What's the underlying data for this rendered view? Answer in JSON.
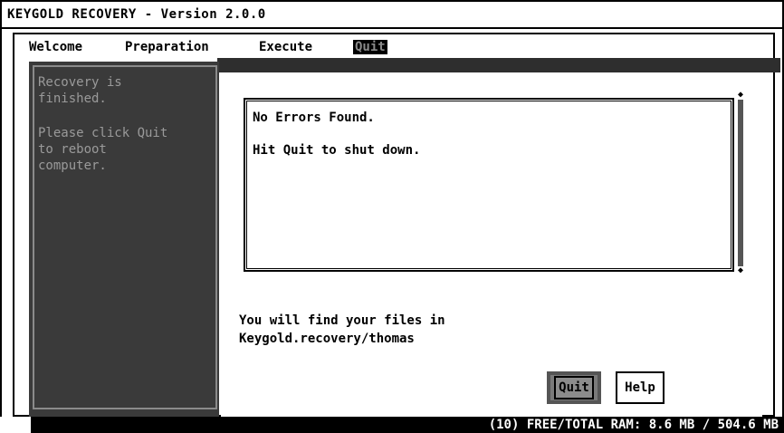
{
  "window": {
    "title": "KEYGOLD RECOVERY - Version 2.0.0"
  },
  "menu": {
    "items": [
      {
        "label": "Welcome"
      },
      {
        "label": "Preparation"
      },
      {
        "label": "Execute"
      },
      {
        "label": "Quit",
        "active": true
      }
    ]
  },
  "sidebar": {
    "line1": "Recovery is",
    "line2": "finished.",
    "line3": "Please click Quit",
    "line4": "to reboot",
    "line5": "computer."
  },
  "messages": {
    "line1": "No Errors Found.",
    "line2": "Hit Quit to shut down."
  },
  "info": {
    "line1": "You will find your files in",
    "line2": "Keygold.recovery/thomas"
  },
  "buttons": {
    "quit_label": "Quit",
    "help_label": "Help"
  },
  "status": {
    "text": "(10)  FREE/TOTAL RAM: 8.6 MB / 504.6 MB"
  },
  "colors": {
    "sidebar_bg": "#3a3a3a",
    "sidebar_text": "#9a9a9a",
    "active_menu_bg": "#000000",
    "status_bg": "#000000"
  },
  "icons": {
    "scroll_up": "scroll-up-arrow-icon",
    "scroll_down": "scroll-down-arrow-icon"
  }
}
